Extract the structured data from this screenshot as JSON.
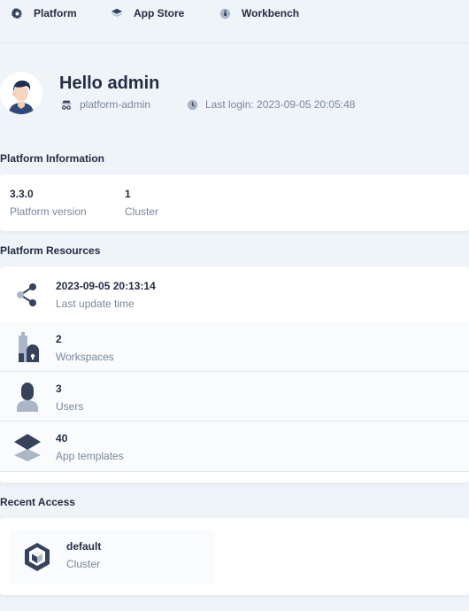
{
  "nav": [
    {
      "label": "Platform",
      "icon": "gear-icon"
    },
    {
      "label": "App Store",
      "icon": "layers-icon"
    },
    {
      "label": "Workbench",
      "icon": "dashboard-icon"
    }
  ],
  "user": {
    "greeting": "Hello admin",
    "role": "platform-admin",
    "last_login": "Last login: 2023-09-05 20:05:48"
  },
  "platform_info": {
    "title": "Platform Information",
    "items": [
      {
        "value": "3.3.0",
        "label": "Platform version"
      },
      {
        "value": "1",
        "label": "Cluster"
      }
    ]
  },
  "platform_resources": {
    "title": "Platform Resources",
    "items": [
      {
        "value": "2023-09-05 20:13:14",
        "label": "Last update time",
        "icon": "share-icon"
      },
      {
        "value": "2",
        "label": "Workspaces",
        "icon": "workspace-icon"
      },
      {
        "value": "3",
        "label": "Users",
        "icon": "user-icon"
      },
      {
        "value": "40",
        "label": "App templates",
        "icon": "app-template-icon"
      }
    ]
  },
  "recent_access": {
    "title": "Recent Access",
    "items": [
      {
        "name": "default",
        "type": "Cluster",
        "icon": "cluster-icon"
      }
    ]
  },
  "colors": {
    "background": "#eff4f9",
    "text": "#242e42",
    "muted": "#79879c",
    "icon_dark": "#36435c",
    "icon_light": "#abb6c8"
  }
}
